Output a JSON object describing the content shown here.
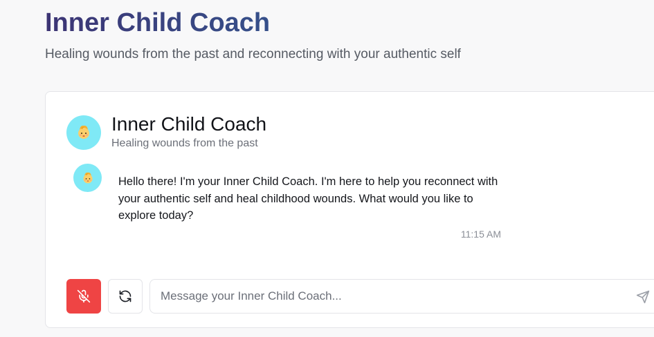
{
  "header": {
    "title": "Inner Child Coach",
    "subtitle": "Healing wounds from the past and reconnecting with your authentic self"
  },
  "chat": {
    "coach_name": "Inner Child Coach",
    "coach_tagline": "Healing wounds from the past",
    "avatar_icon": "baby-face-emoji",
    "messages": [
      {
        "sender": "coach",
        "text": "Hello there! I'm your Inner Child Coach. I'm here to help you reconnect with your authentic self and heal childhood wounds. What would you like to explore today?",
        "time": "11:15 AM"
      }
    ]
  },
  "input": {
    "placeholder": "Message your Inner Child Coach...",
    "value": ""
  },
  "controls": {
    "mic_icon": "mic-off-icon",
    "refresh_icon": "refresh-icon",
    "send_icon": "send-icon"
  },
  "colors": {
    "title_gradient_start": "#3c3474",
    "title_gradient_end": "#36508a",
    "avatar_bg": "#7fe9f6",
    "mic_button_bg": "#ef4444",
    "card_bg": "#ffffff",
    "page_bg": "#f8f8f9"
  }
}
